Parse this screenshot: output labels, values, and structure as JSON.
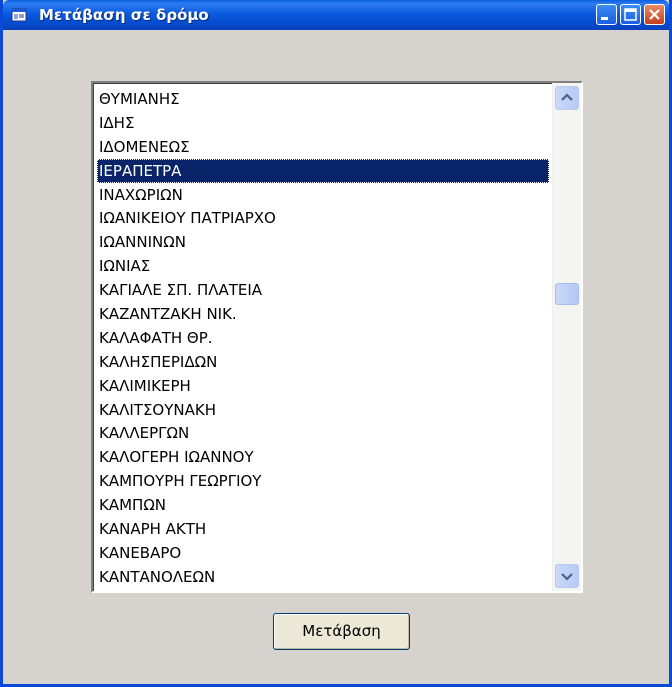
{
  "window": {
    "title": "Μετάβαση σε δρόμο",
    "controls": [
      "minimize-icon",
      "maximize-icon",
      "close-icon"
    ]
  },
  "street_list": {
    "items": [
      "ΘΥΜΙΑΝΗΣ",
      "ΙΔΗΣ",
      "ΙΔΟΜΕΝΕΩΣ",
      "ΙΕΡΑΠΕΤΡΑ",
      "ΙΝΑΧΩΡΙΩΝ",
      "ΙΩΑΝΙΚΕΙΟΥ ΠΑΤΡΙΑΡΧΟ",
      "ΙΩΑΝΝΙΝΩΝ",
      "ΙΩΝΙΑΣ",
      "ΚΑΓΙΑΛΕ ΣΠ. ΠΛΑΤΕΙΑ",
      "ΚΑΖΑΝΤΖΑΚΗ ΝΙΚ.",
      "ΚΑΛΑΦΑΤΗ ΘΡ.",
      "ΚΑΛΗΣΠΕΡΙΔΩΝ",
      "ΚΑΛΙΜΙΚΕΡΗ",
      "ΚΑΛΙΤΣΟΥΝΑΚΗ",
      "ΚΑΛΛΕΡΓΩΝ",
      "ΚΑΛΟΓΕΡΗ ΙΩΑΝΝΟΥ",
      "ΚΑΜΠΟΥΡΗ ΓΕΩΡΓΙΟΥ",
      "ΚΑΜΠΩΝ",
      "ΚΑΝΑΡΗ ΑΚΤΗ",
      "ΚΑΝΕΒΑΡΟ",
      "ΚΑΝΤΑΝΟΛΕΩΝ"
    ],
    "selected_index": 3,
    "scroll_position": 0.4
  },
  "actions": {
    "go_label": "Μετάβαση"
  },
  "colors": {
    "titlebar": "#0a5fdf",
    "window_bg": "#d6d3ce",
    "selection_bg": "#0a246a",
    "close_button": "#c43f1c"
  }
}
